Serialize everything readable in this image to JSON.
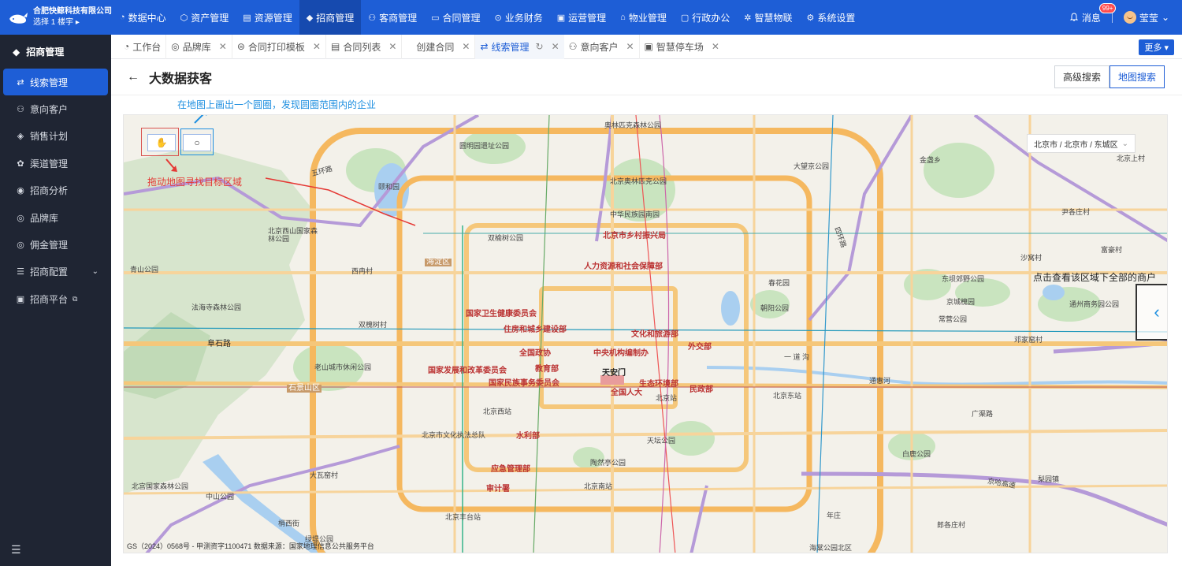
{
  "brand": {
    "name": "合肥快鲸科技有限公司",
    "sub": "选择 1 楼宇 ▸"
  },
  "nav": [
    {
      "label": "数据中心",
      "icon": "◔"
    },
    {
      "label": "资产管理",
      "icon": "⬡"
    },
    {
      "label": "资源管理",
      "icon": "▤"
    },
    {
      "label": "招商管理",
      "icon": "◆"
    },
    {
      "label": "客商管理",
      "icon": "⚇"
    },
    {
      "label": "合同管理",
      "icon": "▭"
    },
    {
      "label": "业务财务",
      "icon": "⊙"
    },
    {
      "label": "运营管理",
      "icon": "▣"
    },
    {
      "label": "物业管理",
      "icon": "⌂"
    },
    {
      "label": "行政办公",
      "icon": "▢"
    },
    {
      "label": "智慧物联",
      "icon": "✲"
    },
    {
      "label": "系统设置",
      "icon": "⚙"
    }
  ],
  "header": {
    "msg_label": "消息",
    "msg_badge": "99+",
    "user_name": "莹莹"
  },
  "sidebar": {
    "title": "招商管理",
    "items": [
      {
        "label": "线索管理",
        "icon": "⇄"
      },
      {
        "label": "意向客户",
        "icon": "⚇"
      },
      {
        "label": "销售计划",
        "icon": "◈"
      },
      {
        "label": "渠道管理",
        "icon": "✿"
      },
      {
        "label": "招商分析",
        "icon": "◉"
      },
      {
        "label": "品牌库",
        "icon": "◎"
      },
      {
        "label": "佣金管理",
        "icon": "◎"
      },
      {
        "label": "招商配置",
        "icon": "☰"
      },
      {
        "label": "招商平台",
        "icon": "▣"
      }
    ]
  },
  "tabs": [
    {
      "label": "工作台",
      "icon": "◔"
    },
    {
      "label": "品牌库",
      "icon": "◎"
    },
    {
      "label": "合同打印模板",
      "icon": "⊜"
    },
    {
      "label": "合同列表",
      "icon": "▤"
    },
    {
      "label": "创建合同",
      "icon": ""
    },
    {
      "label": "线索管理",
      "icon": "⇄"
    },
    {
      "label": "意向客户",
      "icon": "⚇"
    },
    {
      "label": "智慧停车场",
      "icon": "▣"
    }
  ],
  "more_label": "更多 ▾",
  "page": {
    "title": "大数据获客",
    "btn_advanced": "高级搜索",
    "btn_map": "地图搜索"
  },
  "hints": {
    "draw_circle": "在地图上画出一个圆圈，发现圆圈范围内的企业",
    "drag_map": "拖动地图寻找目标区域",
    "click_view": "点击查看该区域下全部的商户"
  },
  "region": "北京市 / 北京市 / 东城区",
  "map_labels": [
    "圆明园遗址公园",
    "奥林匹克森林公园",
    "北京奥林匹克公园",
    "中华民族园南园",
    "颐和园",
    "北京市乡村振兴局",
    "双榆树公园",
    "海淀区",
    "北京西山国家森林公园",
    "西冉村",
    "人力资源和社会保障部",
    "青山公园",
    "法海寺森林公园",
    "国家卫生健康委员会",
    "住房和城乡建设部",
    "双槐树村",
    "文化和旅游部",
    "外交部",
    "中央机构编制办",
    "全国政协",
    "教育部",
    "国家发展和改革委员会",
    "国家民族事务委员会",
    "天安门",
    "生态环境部",
    "民政部",
    "全国人大",
    "北京站",
    "北京东站",
    "北京西站",
    "老山城市休闲公园",
    "石景山区",
    "北京市文化执法总队",
    "水利部",
    "天坛公园",
    "陶然亭公园",
    "应急管理部",
    "审计署",
    "北京南站",
    "北京丰台站",
    "大瓦窑村",
    "北宫国家森林公园",
    "中山公园",
    "梢西街",
    "绿堤公园",
    "大望京公园",
    "金盏乡",
    "北京上村",
    "尹各庄村",
    "富豪村",
    "沙窝村",
    "东坝郊野公园",
    "京城槐园",
    "常营公园",
    "通州商务园公园",
    "邓家窑村",
    "朝阳公园",
    "春花园",
    "白鹿公园",
    "梨园镇",
    "年庄",
    "郎各庄村",
    "海棠公园北区",
    "五环路",
    "阜石路",
    "四环路",
    "广渠路",
    "京哈高速",
    "通惠河",
    "一 道 沟"
  ],
  "copyright": "GS（2024）0568号 - 甲测资字1100471 数据来源：国家地理信息公共服务平台"
}
